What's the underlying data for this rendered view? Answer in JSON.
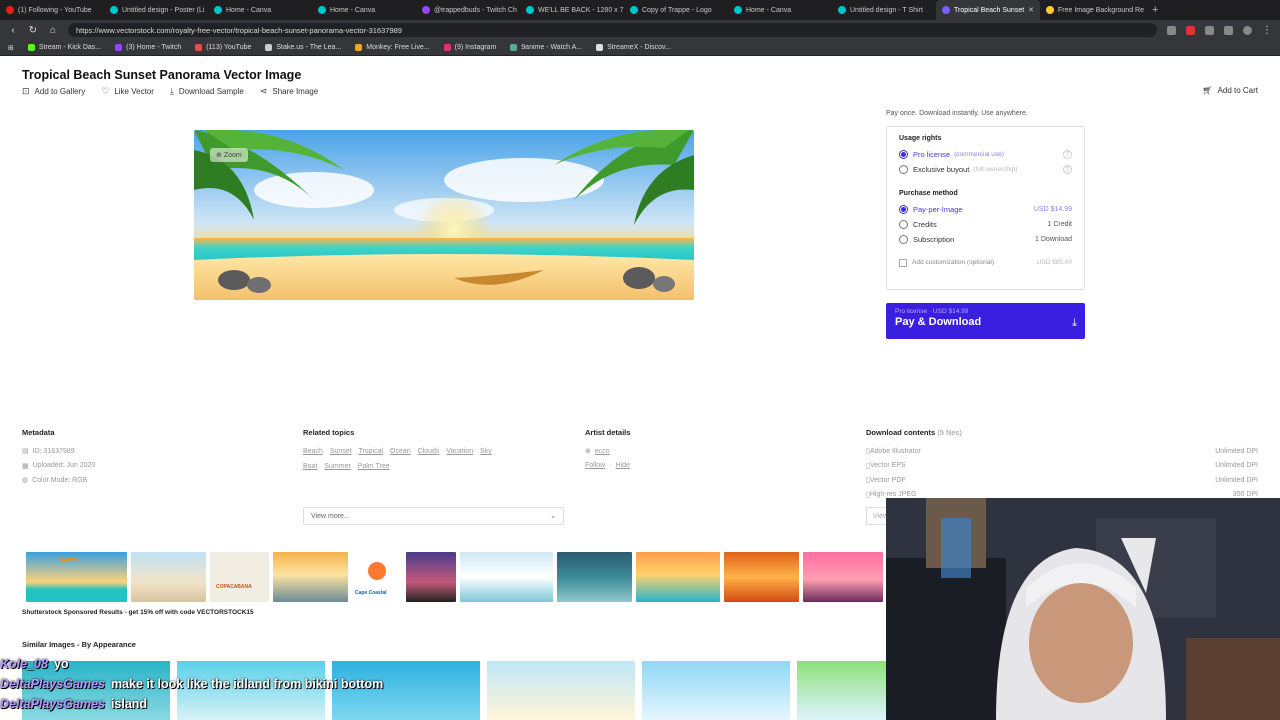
{
  "browser": {
    "tabs": [
      {
        "label": "(1) Following - YouTube"
      },
      {
        "label": "Untitled design - Poster (Li"
      },
      {
        "label": "Home - Canva"
      },
      {
        "label": "Home - Canva"
      },
      {
        "label": "@trappedbuds - Twitch Ch"
      },
      {
        "label": "WE'LL BE BACK - 1280 x 7"
      },
      {
        "label": "Copy of Trappe - Logo"
      },
      {
        "label": "Home - Canva"
      },
      {
        "label": "Untitled design - T Shirt"
      },
      {
        "label": "Tropical Beach Sunset"
      },
      {
        "label": "Free Image Background Re"
      }
    ],
    "url": "https://www.vectorstock.com/royalty-free-vector/tropical-beach-sunset-panorama-vector-31637989",
    "bookmarks": [
      "Stream - Kick Das...",
      "(3) Home - Twitch",
      "(113) YouTube",
      "Stake.us - The Lea...",
      "Monkey: Free Live...",
      "(9) Instagram",
      "9anime - Watch A...",
      "StreameX - Discov..."
    ]
  },
  "page": {
    "title": "Tropical Beach Sunset Panorama Vector Image",
    "actions": [
      "Add to Gallery",
      "Like Vector",
      "Download Sample",
      "Share Image"
    ],
    "cart": "Add to Cart",
    "zoom": "Zoom"
  },
  "purchase": {
    "tagline": "Pay once. Download instantly. Use anywhere.",
    "usage_title": "Usage rights",
    "pro_license": "Pro license",
    "pro_hint": "(commercial use)",
    "exclusive": "Exclusive buyout",
    "exclusive_hint": "(full ownership)",
    "method_title": "Purchase method",
    "ppi": "Pay-per-Image",
    "ppi_price": "USD $14.99",
    "credits": "Credits",
    "credits_price": "1 Credit",
    "subscription": "Subscription",
    "subscription_price": "1 Download",
    "customization": "Add customization (optional)",
    "customization_price": "USD $85.00",
    "button_sub": "Pro license · USD $14.99",
    "button_label": "Pay & Download"
  },
  "metadata": {
    "title": "Metadata",
    "id": "ID: 31637989",
    "uploaded": "Uploaded: Jun 2020",
    "color_mode": "Color Mode: RGB"
  },
  "related": {
    "title": "Related topics",
    "tags": [
      "Beach",
      "Sunset",
      "Tropical",
      "Ocean",
      "Clouds",
      "Vacation",
      "Sky",
      "Boat",
      "Summer",
      "Palm Tree"
    ],
    "view_more": "View more..."
  },
  "artist": {
    "title": "Artist details",
    "name": "ecco",
    "follow": "Follow",
    "hide": "Hide"
  },
  "downloads": {
    "title": "Download contents",
    "count": "(5 files)",
    "files": [
      {
        "name": "Adobe Illustrator",
        "res": "Unlimited DPI"
      },
      {
        "name": "Vector EPS",
        "res": "Unlimited DPI"
      },
      {
        "name": "Vector PDF",
        "res": "Unlimited DPI"
      },
      {
        "name": "High-res JPEG",
        "res": "300 DPI"
      }
    ],
    "view": "View"
  },
  "strip": {
    "thumb_text_1": "HAWAII",
    "thumb_text_3": "COPACABANA",
    "thumb_text_5": "Cape Coastal",
    "sponsored": "Shutterstock Sponsored Results - get 15% off with code VECTORSTOCK15"
  },
  "similar": {
    "title": "Similar Images - By Appearance"
  },
  "overlay": {
    "lines": [
      {
        "user": "Kole_08",
        "text": "yo"
      },
      {
        "user": "DeltaPlaysGames",
        "text": "make it look like the idland from bikini bottom"
      },
      {
        "user": "DeltaPlaysGames",
        "text": "island"
      }
    ]
  }
}
